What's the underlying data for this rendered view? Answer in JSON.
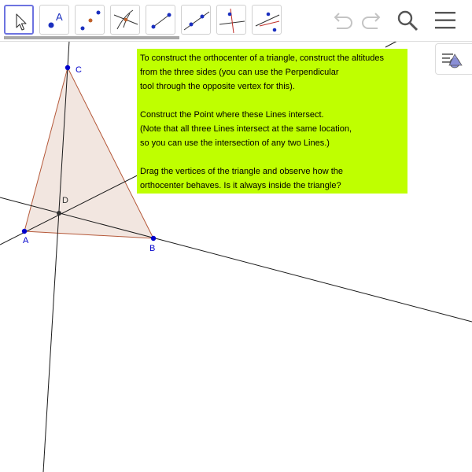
{
  "toolbar": {
    "tools": [
      {
        "name": "Move",
        "icon": "move-cursor-icon"
      },
      {
        "name": "Point",
        "icon": "point-icon"
      },
      {
        "name": "Intersect",
        "icon": "intersect-icon"
      },
      {
        "name": "Perpendicular Line",
        "icon": "perpendicular-line-icon"
      },
      {
        "name": "Segment",
        "icon": "segment-icon"
      },
      {
        "name": "Line",
        "icon": "line-icon"
      },
      {
        "name": "Perpendicular Bisector",
        "icon": "perpendicular-bisector-icon"
      },
      {
        "name": "Angle Bisector",
        "icon": "angle-bisector-icon"
      }
    ],
    "selected_tool": "Move",
    "point_tool_letter": "A"
  },
  "controls": {
    "undo": "undo-icon",
    "redo": "redo-icon",
    "search": "search-icon",
    "menu": "menu-icon",
    "algebra_toggle": "algebra-view-icon"
  },
  "info_box": {
    "paragraph1": "To construct the orthocenter of a triangle, construct the altitudes\nfrom the three sides (you can use the Perpendicular\ntool through the opposite vertex for this).",
    "paragraph2": "Construct the Point where these Lines intersect.\n(Note that all three Lines intersect at the same location,\nso you can use the intersection of any two Lines.)",
    "paragraph3": "Drag the vertices of the triangle and observe how the\northocenter behaves. Is it always inside the triangle?",
    "background": "#bfff00"
  },
  "construction": {
    "points": {
      "A": {
        "label": "A",
        "color": "#0000cc"
      },
      "B": {
        "label": "B",
        "color": "#0000cc"
      },
      "C": {
        "label": "C",
        "color": "#0000cc"
      },
      "D": {
        "label": "D",
        "color": "#333333"
      }
    },
    "triangle_fill": "#f2e6e0",
    "triangle_stroke": "#b5593a"
  }
}
